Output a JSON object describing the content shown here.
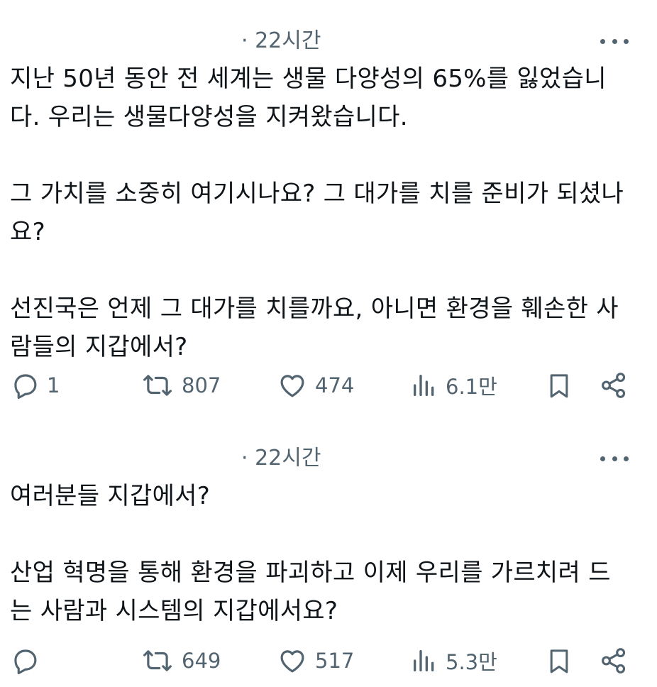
{
  "posts": [
    {
      "time": "· 22시간",
      "paragraphs": [
        [
          "지난 50년 동안 전 세계는 생물 다양성의 65%를 잃었습니",
          "다. 우리는 생물다양성을 지켜왔습니다."
        ],
        [
          "그 가치를 소중히 여기시나요? 그 대가를 치를 준비가 되셨나",
          "요?"
        ],
        [
          "선진국은 언제 그 대가를 치를까요, 아니면 환경을 훼손한 사",
          "람들의 지갑에서?"
        ]
      ],
      "reply_count": "1",
      "repost_count": "807",
      "like_count": "474",
      "view_count": "6.1만"
    },
    {
      "time": "· 22시간",
      "paragraphs": [
        [
          "여러분들 지갑에서?"
        ],
        [
          "산업 혁명을 통해 환경을 파괴하고 이제 우리를 가르치려 드",
          "는 사람과 시스템의 지갑에서요?"
        ]
      ],
      "reply_count": "",
      "repost_count": "649",
      "like_count": "517",
      "view_count": "5.3만"
    }
  ],
  "icons": {
    "reply": "reply-icon",
    "repost": "repost-icon",
    "like": "heart-icon",
    "views": "views-icon",
    "bookmark": "bookmark-icon",
    "share": "share-icon",
    "more": "more-icon"
  },
  "colors": {
    "text": "#0f1419",
    "secondary": "#536471",
    "background": "#ffffff"
  }
}
